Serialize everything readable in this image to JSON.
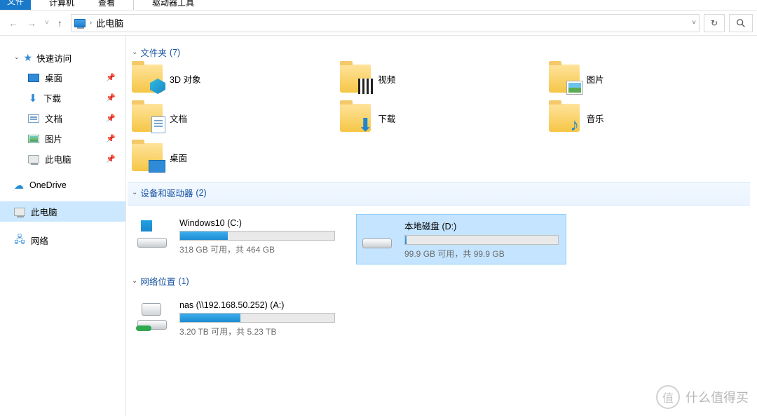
{
  "tabs": {
    "file": "文件",
    "computer": "计算机",
    "view": "查看",
    "drivetools": "驱动器工具"
  },
  "address": {
    "location": "此电脑"
  },
  "sidebar": {
    "quick": {
      "label": "快速访问",
      "items": [
        {
          "label": "桌面"
        },
        {
          "label": "下载"
        },
        {
          "label": "文档"
        },
        {
          "label": "图片"
        },
        {
          "label": "此电脑"
        }
      ]
    },
    "onedrive": "OneDrive",
    "thispc": "此电脑",
    "network": "网络"
  },
  "sections": {
    "folders": {
      "title": "文件夹",
      "count": "(7)"
    },
    "devices": {
      "title": "设备和驱动器",
      "count": "(2)"
    },
    "netloc": {
      "title": "网络位置",
      "count": "(1)"
    }
  },
  "folders": [
    {
      "label": "3D 对象",
      "ov": "3d"
    },
    {
      "label": "视频",
      "ov": "vid"
    },
    {
      "label": "图片",
      "ov": "pic"
    },
    {
      "label": "文档",
      "ov": "doc"
    },
    {
      "label": "下载",
      "ov": "dl"
    },
    {
      "label": "音乐",
      "ov": "mus"
    },
    {
      "label": "桌面",
      "ov": "desk"
    }
  ],
  "drives": [
    {
      "name": "Windows10 (C:)",
      "sub": "318 GB 可用，共 464 GB",
      "fillPct": 31,
      "kind": "win",
      "sel": false
    },
    {
      "name": "本地磁盘 (D:)",
      "sub": "99.9 GB 可用，共 99.9 GB",
      "fillPct": 1,
      "kind": "plain",
      "sel": true
    }
  ],
  "netdrives": [
    {
      "name": "nas (\\\\192.168.50.252) (A:)",
      "sub": "3.20 TB 可用，共 5.23 TB",
      "fillPct": 39,
      "kind": "net"
    }
  ],
  "watermark": "什么值得买"
}
